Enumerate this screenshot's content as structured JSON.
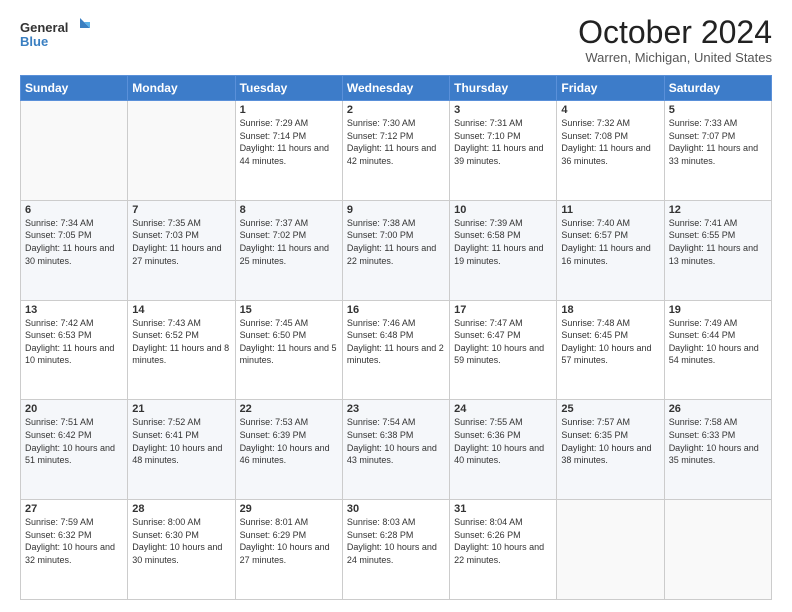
{
  "header": {
    "logo_line1": "General",
    "logo_line2": "Blue",
    "title": "October 2024",
    "subtitle": "Warren, Michigan, United States"
  },
  "weekdays": [
    "Sunday",
    "Monday",
    "Tuesday",
    "Wednesday",
    "Thursday",
    "Friday",
    "Saturday"
  ],
  "weeks": [
    [
      {
        "day": "",
        "info": ""
      },
      {
        "day": "",
        "info": ""
      },
      {
        "day": "1",
        "info": "Sunrise: 7:29 AM\nSunset: 7:14 PM\nDaylight: 11 hours and 44 minutes."
      },
      {
        "day": "2",
        "info": "Sunrise: 7:30 AM\nSunset: 7:12 PM\nDaylight: 11 hours and 42 minutes."
      },
      {
        "day": "3",
        "info": "Sunrise: 7:31 AM\nSunset: 7:10 PM\nDaylight: 11 hours and 39 minutes."
      },
      {
        "day": "4",
        "info": "Sunrise: 7:32 AM\nSunset: 7:08 PM\nDaylight: 11 hours and 36 minutes."
      },
      {
        "day": "5",
        "info": "Sunrise: 7:33 AM\nSunset: 7:07 PM\nDaylight: 11 hours and 33 minutes."
      }
    ],
    [
      {
        "day": "6",
        "info": "Sunrise: 7:34 AM\nSunset: 7:05 PM\nDaylight: 11 hours and 30 minutes."
      },
      {
        "day": "7",
        "info": "Sunrise: 7:35 AM\nSunset: 7:03 PM\nDaylight: 11 hours and 27 minutes."
      },
      {
        "day": "8",
        "info": "Sunrise: 7:37 AM\nSunset: 7:02 PM\nDaylight: 11 hours and 25 minutes."
      },
      {
        "day": "9",
        "info": "Sunrise: 7:38 AM\nSunset: 7:00 PM\nDaylight: 11 hours and 22 minutes."
      },
      {
        "day": "10",
        "info": "Sunrise: 7:39 AM\nSunset: 6:58 PM\nDaylight: 11 hours and 19 minutes."
      },
      {
        "day": "11",
        "info": "Sunrise: 7:40 AM\nSunset: 6:57 PM\nDaylight: 11 hours and 16 minutes."
      },
      {
        "day": "12",
        "info": "Sunrise: 7:41 AM\nSunset: 6:55 PM\nDaylight: 11 hours and 13 minutes."
      }
    ],
    [
      {
        "day": "13",
        "info": "Sunrise: 7:42 AM\nSunset: 6:53 PM\nDaylight: 11 hours and 10 minutes."
      },
      {
        "day": "14",
        "info": "Sunrise: 7:43 AM\nSunset: 6:52 PM\nDaylight: 11 hours and 8 minutes."
      },
      {
        "day": "15",
        "info": "Sunrise: 7:45 AM\nSunset: 6:50 PM\nDaylight: 11 hours and 5 minutes."
      },
      {
        "day": "16",
        "info": "Sunrise: 7:46 AM\nSunset: 6:48 PM\nDaylight: 11 hours and 2 minutes."
      },
      {
        "day": "17",
        "info": "Sunrise: 7:47 AM\nSunset: 6:47 PM\nDaylight: 10 hours and 59 minutes."
      },
      {
        "day": "18",
        "info": "Sunrise: 7:48 AM\nSunset: 6:45 PM\nDaylight: 10 hours and 57 minutes."
      },
      {
        "day": "19",
        "info": "Sunrise: 7:49 AM\nSunset: 6:44 PM\nDaylight: 10 hours and 54 minutes."
      }
    ],
    [
      {
        "day": "20",
        "info": "Sunrise: 7:51 AM\nSunset: 6:42 PM\nDaylight: 10 hours and 51 minutes."
      },
      {
        "day": "21",
        "info": "Sunrise: 7:52 AM\nSunset: 6:41 PM\nDaylight: 10 hours and 48 minutes."
      },
      {
        "day": "22",
        "info": "Sunrise: 7:53 AM\nSunset: 6:39 PM\nDaylight: 10 hours and 46 minutes."
      },
      {
        "day": "23",
        "info": "Sunrise: 7:54 AM\nSunset: 6:38 PM\nDaylight: 10 hours and 43 minutes."
      },
      {
        "day": "24",
        "info": "Sunrise: 7:55 AM\nSunset: 6:36 PM\nDaylight: 10 hours and 40 minutes."
      },
      {
        "day": "25",
        "info": "Sunrise: 7:57 AM\nSunset: 6:35 PM\nDaylight: 10 hours and 38 minutes."
      },
      {
        "day": "26",
        "info": "Sunrise: 7:58 AM\nSunset: 6:33 PM\nDaylight: 10 hours and 35 minutes."
      }
    ],
    [
      {
        "day": "27",
        "info": "Sunrise: 7:59 AM\nSunset: 6:32 PM\nDaylight: 10 hours and 32 minutes."
      },
      {
        "day": "28",
        "info": "Sunrise: 8:00 AM\nSunset: 6:30 PM\nDaylight: 10 hours and 30 minutes."
      },
      {
        "day": "29",
        "info": "Sunrise: 8:01 AM\nSunset: 6:29 PM\nDaylight: 10 hours and 27 minutes."
      },
      {
        "day": "30",
        "info": "Sunrise: 8:03 AM\nSunset: 6:28 PM\nDaylight: 10 hours and 24 minutes."
      },
      {
        "day": "31",
        "info": "Sunrise: 8:04 AM\nSunset: 6:26 PM\nDaylight: 10 hours and 22 minutes."
      },
      {
        "day": "",
        "info": ""
      },
      {
        "day": "",
        "info": ""
      }
    ]
  ]
}
